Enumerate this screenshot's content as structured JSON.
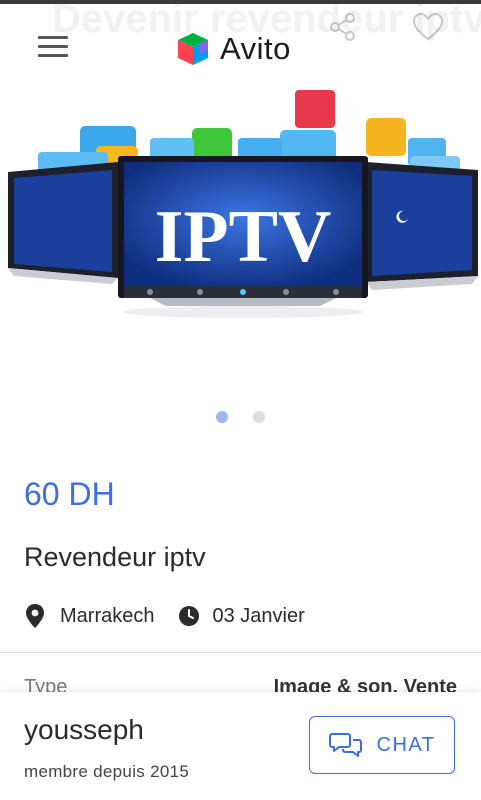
{
  "header": {
    "ghost_title": "Devenir revendeur iptv",
    "brand": "Avito",
    "icons": [
      "menu-icon",
      "avito-logo-icon",
      "share-icon",
      "heart-icon"
    ]
  },
  "gallery": {
    "image_text": "IPTV",
    "dots_total": 2,
    "active_index": 0
  },
  "listing": {
    "price": "60 DH",
    "title": "Revendeur iptv",
    "location": "Marrakech",
    "date": "03 Janvier",
    "detail_label": "Type",
    "detail_value": "Image & son, Vente"
  },
  "seller": {
    "name": "yousseph",
    "since": "membre depuis 2015",
    "chat_label": "CHAT"
  },
  "colors": {
    "accent": "#3d6ee6",
    "active_dot": "#9fb8ee",
    "inactive_dot": "#dedede"
  }
}
